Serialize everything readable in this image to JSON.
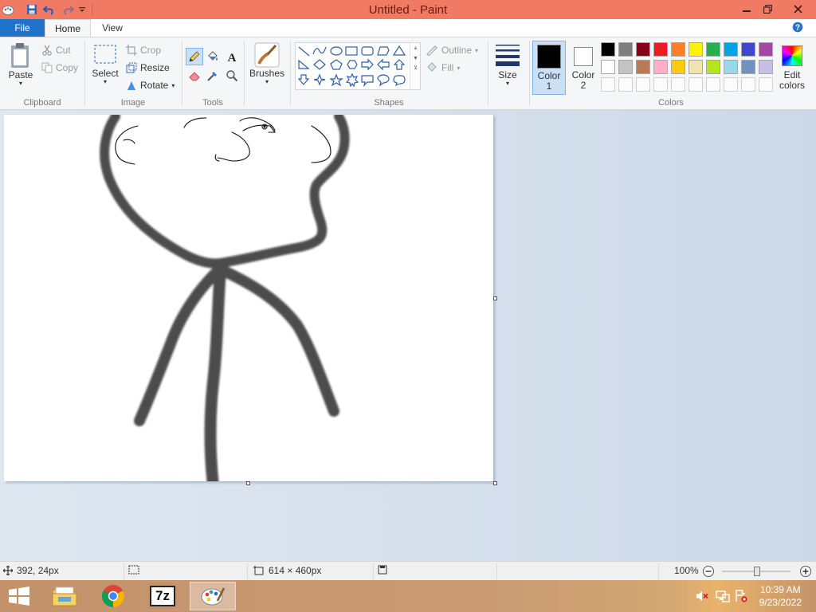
{
  "window": {
    "title": "Untitled - Paint",
    "titlebar_color": "#f07a64"
  },
  "quick_access": {
    "icons": [
      "paint-app-icon",
      "save-icon",
      "undo-icon",
      "redo-icon",
      "customize-dropdown-icon"
    ]
  },
  "tabs": [
    {
      "label": "File"
    },
    {
      "label": "Home"
    },
    {
      "label": "View"
    }
  ],
  "ribbon": {
    "clipboard": {
      "paste": "Paste",
      "cut": "Cut",
      "copy": "Copy",
      "group": "Clipboard"
    },
    "image": {
      "select": "Select",
      "crop": "Crop",
      "resize": "Resize",
      "rotate": "Rotate",
      "group": "Image"
    },
    "tools": {
      "group": "Tools",
      "selected": "pencil"
    },
    "brushes": {
      "label": "Brushes"
    },
    "shapes": {
      "outline": "Outline",
      "fill": "Fill",
      "group": "Shapes"
    },
    "size": {
      "label": "Size"
    },
    "color1": {
      "line1": "Color",
      "line2": "1",
      "value": "#000000"
    },
    "color2": {
      "line1": "Color",
      "line2": "2",
      "value": "#ffffff"
    },
    "edit_colors": {
      "line1": "Edit",
      "line2": "colors"
    },
    "colors_group": "Colors",
    "palette": [
      "#000000",
      "#7f7f7f",
      "#880015",
      "#ed1c24",
      "#ff7f27",
      "#fff200",
      "#22b14c",
      "#00a2e8",
      "#3f48cc",
      "#a349a4",
      "#ffffff",
      "#c3c3c3",
      "#b97a57",
      "#ffaec9",
      "#ffc90e",
      "#efe4b0",
      "#b5e61d",
      "#99d9ea",
      "#7092be",
      "#c8bfe7"
    ],
    "accent": "#1e73c8"
  },
  "status": {
    "cursor_pos": "392, 24px",
    "canvas_size": "614 × 460px",
    "zoom": "100%"
  },
  "taskbar": {
    "apps": [
      "windows-start-icon",
      "file-explorer-icon",
      "chrome-icon",
      "7zip-icon",
      "paint-icon"
    ],
    "app_7zip_label": "7z",
    "time": "10:39 AM",
    "date": "9/23/2022"
  }
}
